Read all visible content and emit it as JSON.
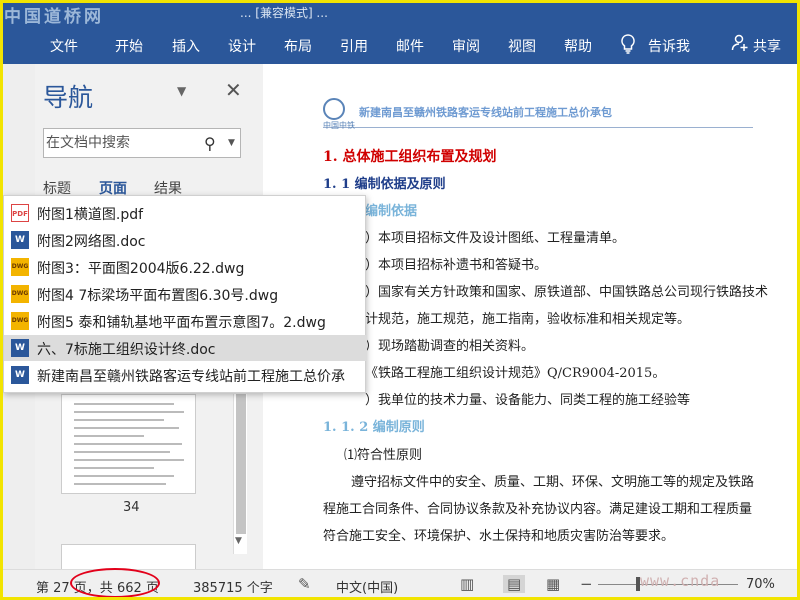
{
  "watermark": {
    "logo_text": "中国道桥网",
    "site": "www.cnda"
  },
  "titlebar": {
    "text": "... [兼容模式] ..."
  },
  "ribbon": {
    "tabs": [
      "文件",
      "开始",
      "插入",
      "设计",
      "布局",
      "引用",
      "邮件",
      "审阅",
      "视图",
      "帮助"
    ],
    "tell_me": "告诉我",
    "share": "共享",
    "lightbulb_icon": "lightbulb-icon",
    "share_icon": "person-add-icon"
  },
  "navigation": {
    "title": "导航",
    "search_placeholder": "在文档中搜索",
    "tabs": [
      "标题",
      "页面",
      "结果"
    ],
    "active_tab": "页面",
    "page_number": "34"
  },
  "recent_files": [
    {
      "name": "附图1横道图.pdf",
      "type": "pdf"
    },
    {
      "name": "附图2网络图.doc",
      "type": "doc"
    },
    {
      "name": "附图3：平面图2004版6.22.dwg",
      "type": "dwg"
    },
    {
      "name": "附图4  7标梁场平面布置图6.30号.dwg",
      "type": "dwg"
    },
    {
      "name": "附图5 泰和铺轨基地平面布置示意图7。2.dwg",
      "type": "dwg"
    },
    {
      "name": "六、7标施工组织设计终.doc",
      "type": "doc",
      "selected": true
    },
    {
      "name": "新建南昌至赣州铁路客运专线站前工程施工总价承",
      "type": "doc"
    }
  ],
  "document": {
    "header_title": "新建南昌至赣州铁路客运专线站前工程施工总价承包",
    "logo_caption": "中国中铁",
    "lines": [
      {
        "text": "1. 总体施工组织布置及规划",
        "style": "h1"
      },
      {
        "text": "1. 1 编制依据及原则",
        "style": "h2"
      },
      {
        "text": "编制依据",
        "style": "h3"
      },
      {
        "text": "）本项目招标文件及设计图纸、工程量清单。",
        "style": "body"
      },
      {
        "text": "）本项目招标补遗书和答疑书。",
        "style": "body"
      },
      {
        "text": "）国家有关方针政策和国家、原铁道部、中国铁路总公司现行铁路技术",
        "style": "body"
      },
      {
        "text": "计规范，施工规范，施工指南，验收标准和相关规定等。",
        "style": "body"
      },
      {
        "text": "）现场踏勘调查的相关资料。",
        "style": "body"
      },
      {
        "text": "《铁路工程施工组织设计规范》Q/CR9004-2015。",
        "style": "body"
      },
      {
        "text": "）我单位的技术力量、设备能力、同类工程的施工经验等",
        "style": "body"
      },
      {
        "text": "1. 1. 2 编制原则",
        "style": "h3"
      },
      {
        "text": "⑴符合性原则",
        "style": "body"
      },
      {
        "text": "遵守招标文件中的安全、质量、工期、环保、文明施工等的规定及铁路",
        "style": "body"
      },
      {
        "text": "程施工合同条件、合同协议条款及补充协议内容。满足建设工期和工程质量",
        "style": "body"
      },
      {
        "text": "符合施工安全、环境保护、水土保持和地质灾害防治等要求。",
        "style": "body"
      }
    ]
  },
  "status": {
    "page_info": "第 27 页，共 662 页",
    "word_count": "385715 个字",
    "language": "中文(中国)",
    "zoom": "70%"
  },
  "colors": {
    "ribbon": "#2b579a",
    "heading1": "#d00000",
    "heading2": "#1f3e8a",
    "heading3": "#7ab4da",
    "annotation": "#e2001a"
  }
}
